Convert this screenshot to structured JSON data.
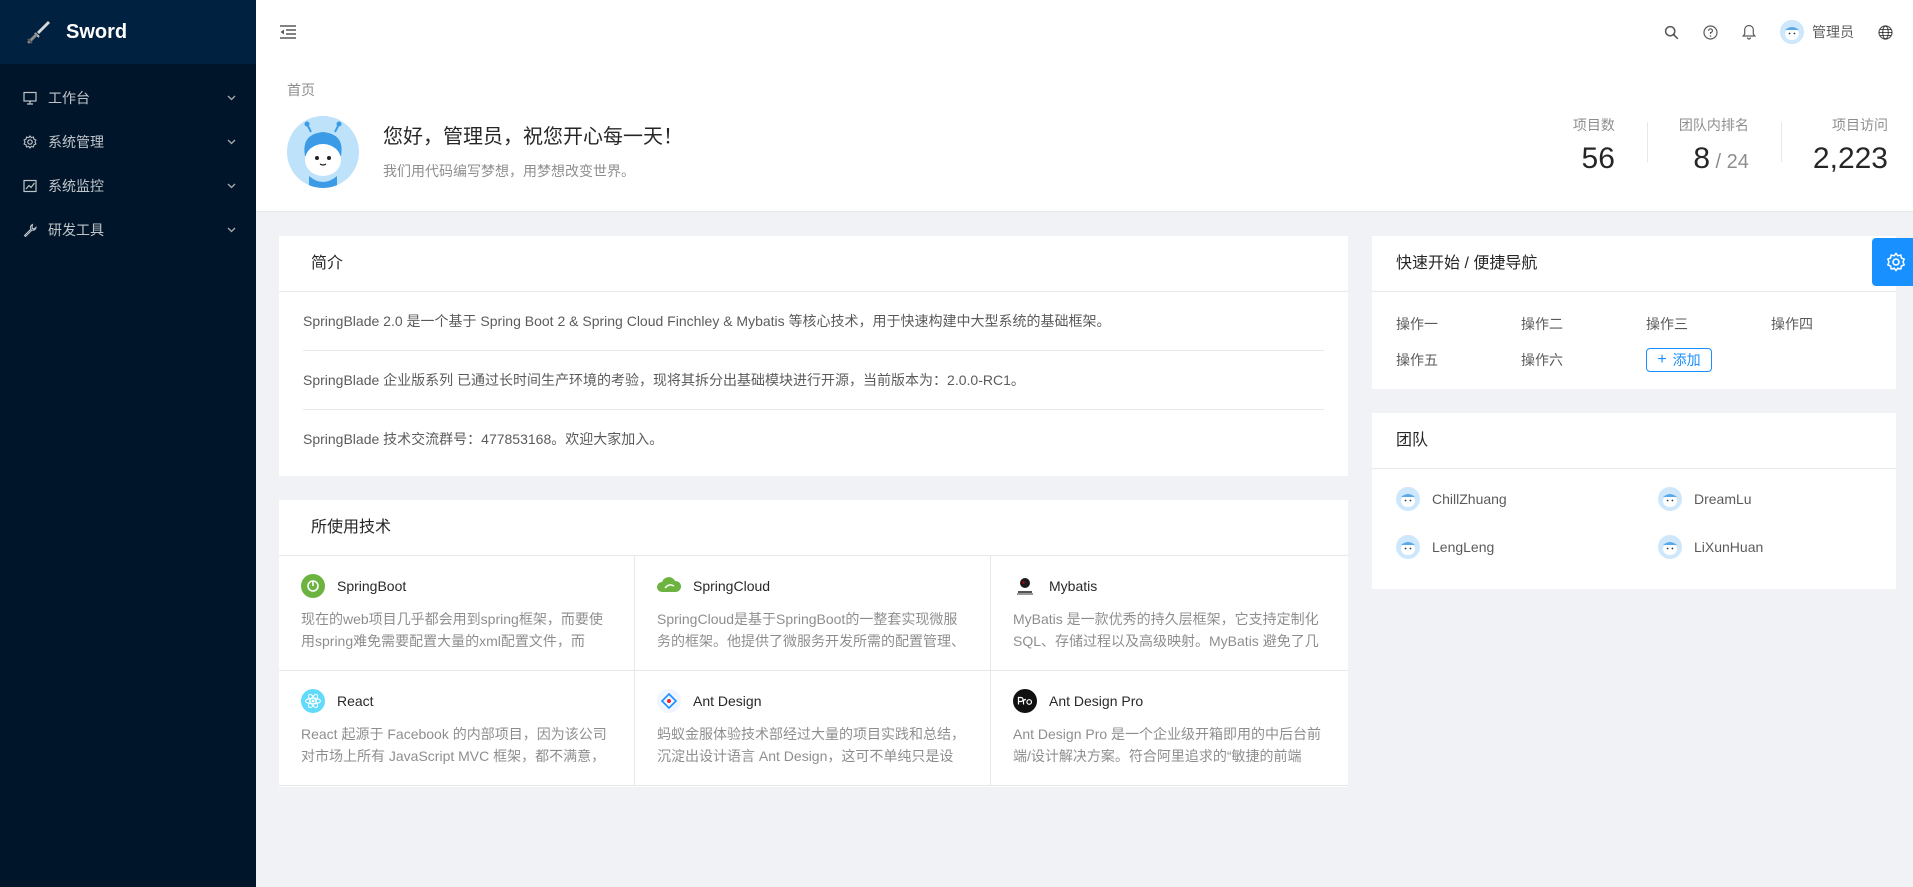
{
  "app": {
    "name": "Sword"
  },
  "sidebar": {
    "items": [
      {
        "label": "工作台",
        "icon": "desktop-icon"
      },
      {
        "label": "系统管理",
        "icon": "setting-icon"
      },
      {
        "label": "系统监控",
        "icon": "monitor-icon"
      },
      {
        "label": "研发工具",
        "icon": "tool-icon"
      }
    ]
  },
  "header": {
    "user_name": "管理员"
  },
  "page": {
    "breadcrumb": "首页",
    "welcome_title": "您好，管理员，祝您开心每一天！",
    "welcome_sub": "我们用代码编写梦想，用梦想改变世界。",
    "stats": [
      {
        "label": "项目数",
        "value": "56",
        "sub": ""
      },
      {
        "label": "团队内排名",
        "value": "8",
        "sub": " / 24"
      },
      {
        "label": "项目访问",
        "value": "2,223",
        "sub": ""
      }
    ]
  },
  "intro": {
    "title": "简介",
    "lines": [
      "SpringBlade 2.0 是一个基于 Spring Boot 2 & Spring Cloud Finchley & Mybatis 等核心技术，用于快速构建中大型系统的基础框架。",
      "SpringBlade 企业版系列 已通过长时间生产环境的考验，现将其拆分出基础模块进行开源，当前版本为：2.0.0-RC1。",
      "SpringBlade 技术交流群号：477853168。欢迎大家加入。"
    ]
  },
  "tech": {
    "title": "所使用技术",
    "items": [
      {
        "name": "SpringBoot",
        "desc": "现在的web项目几乎都会用到spring框架，而要使用spring难免需要配置大量的xml配置文件，而",
        "icon": "springboot-icon"
      },
      {
        "name": "SpringCloud",
        "desc": "SpringCloud是基于SpringBoot的一整套实现微服务的框架。他提供了微服务开发所需的配置管理、",
        "icon": "springcloud-icon"
      },
      {
        "name": "Mybatis",
        "desc": "MyBatis 是一款优秀的持久层框架，它支持定制化 SQL、存储过程以及高级映射。MyBatis 避免了几",
        "icon": "mybatis-icon"
      },
      {
        "name": "React",
        "desc": "React 起源于 Facebook 的内部项目，因为该公司对市场上所有 JavaScript MVC 框架，都不满意，",
        "icon": "react-icon"
      },
      {
        "name": "Ant Design",
        "desc": "蚂蚁金服体验技术部经过大量的项目实践和总结，沉淀出设计语言 Ant Design，这可不单纯只是设",
        "icon": "ant-design-icon"
      },
      {
        "name": "Ant Design Pro",
        "desc": "Ant Design Pro 是一个企业级开箱即用的中后台前端/设计解决方案。符合阿里追求的“敏捷的前端",
        "icon": "ant-design-pro-icon"
      }
    ]
  },
  "quick": {
    "title": "快速开始 / 便捷导航",
    "links": [
      "操作一",
      "操作二",
      "操作三",
      "操作四",
      "操作五",
      "操作六"
    ],
    "add_label": "添加"
  },
  "team": {
    "title": "团队",
    "members": [
      "ChillZhuang",
      "DreamLu",
      "LengLeng",
      "LiXunHuan"
    ]
  },
  "colors": {
    "sidebar_bg": "#001529",
    "logo_bg": "#002140",
    "primary": "#1890ff",
    "page_bg": "#f0f2f5"
  }
}
